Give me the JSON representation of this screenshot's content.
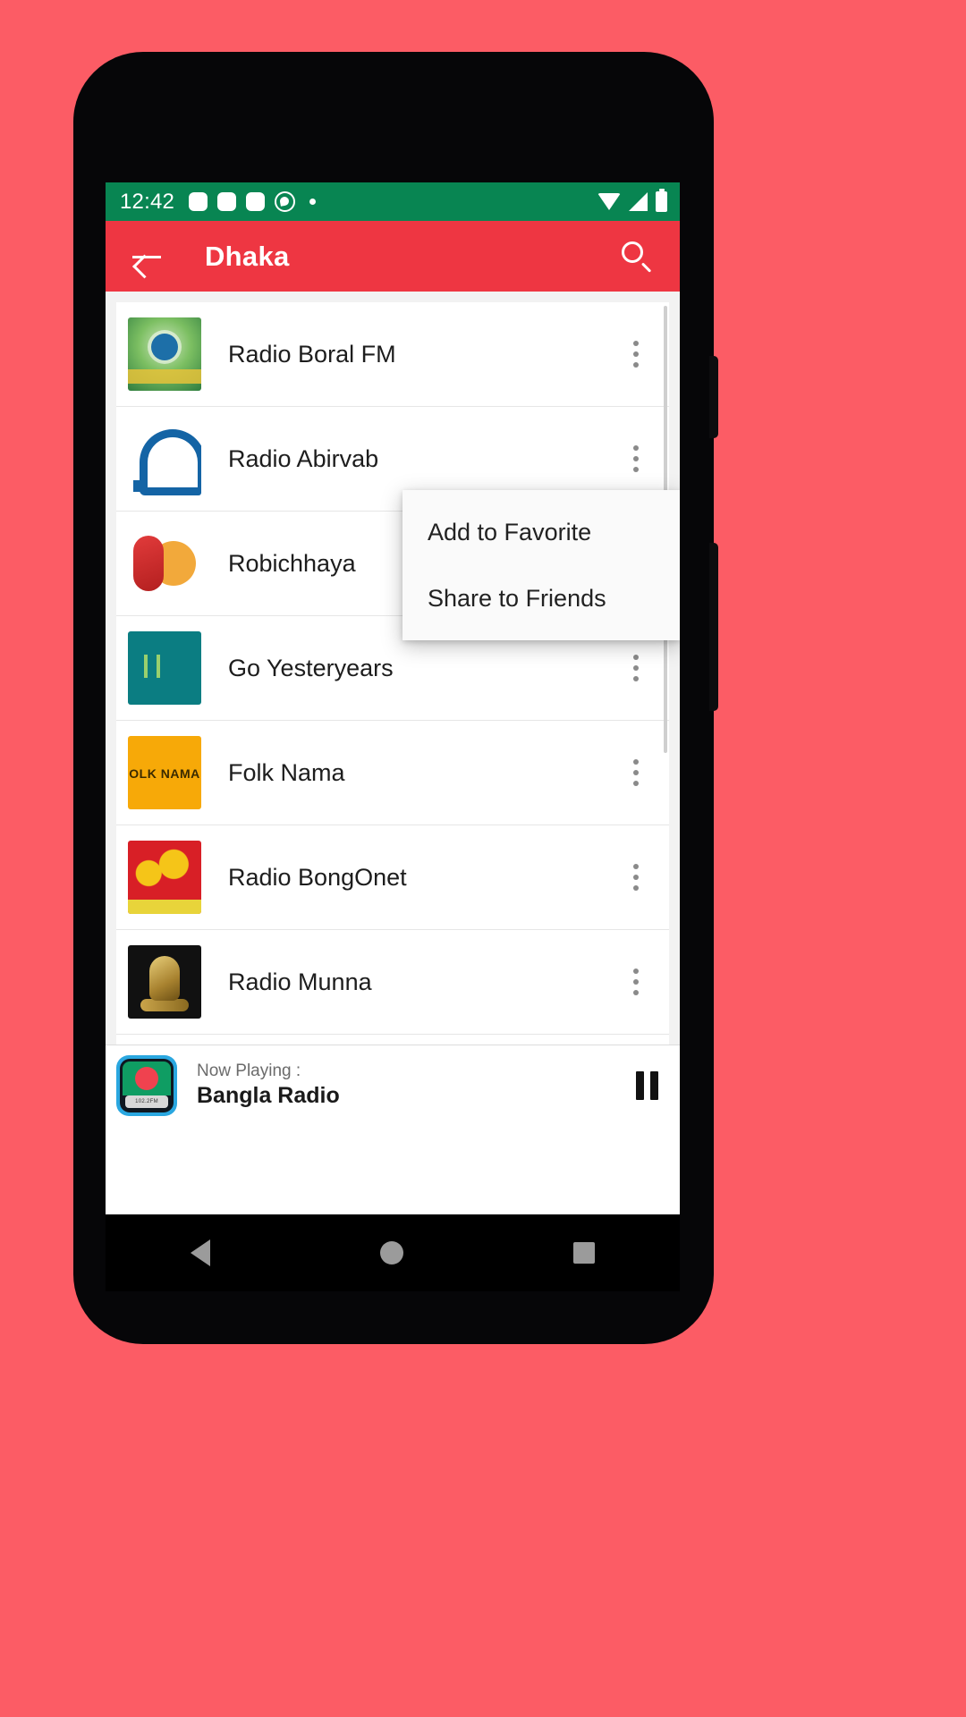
{
  "status_bar": {
    "time": "12:42",
    "left_icons": [
      "notification-square",
      "notification-square",
      "notification-square",
      "notification-circle",
      "notification-dot"
    ],
    "right_icons": [
      "wifi-icon",
      "signal-icon",
      "battery-icon"
    ],
    "background_color": "#088552"
  },
  "app_bar": {
    "back_label": "back-arrow",
    "title": "Dhaka",
    "search_label": "search-icon",
    "background_color": "#EE3642"
  },
  "stations": [
    {
      "name": "Radio Boral FM",
      "logo": "logo-boral",
      "logo_text": ""
    },
    {
      "name": "Radio Abirvab",
      "logo": "logo-abirvab",
      "logo_text": ""
    },
    {
      "name": "Robichhaya",
      "logo": "logo-robi",
      "logo_text": ""
    },
    {
      "name": "Go Yesteryears",
      "logo": "logo-goyester",
      "logo_text": ""
    },
    {
      "name": "Folk Nama",
      "logo": "logo-folk",
      "logo_text": "OLK NAMA"
    },
    {
      "name": "Radio BongOnet",
      "logo": "logo-bong",
      "logo_text": ""
    },
    {
      "name": "Radio Munna",
      "logo": "logo-munna",
      "logo_text": ""
    }
  ],
  "popup_menu": {
    "items": [
      {
        "label": "Add to Favorite"
      },
      {
        "label": "Share to Friends"
      }
    ]
  },
  "now_playing": {
    "label": "Now Playing :",
    "title": "Bangla Radio",
    "artwork_text": "102.2FM",
    "transport_state": "pause-icon"
  },
  "nav_bar": {
    "buttons": [
      "back-triangle-icon",
      "home-circle-icon",
      "recents-square-icon"
    ]
  },
  "page_background_color": "#FC5C65"
}
